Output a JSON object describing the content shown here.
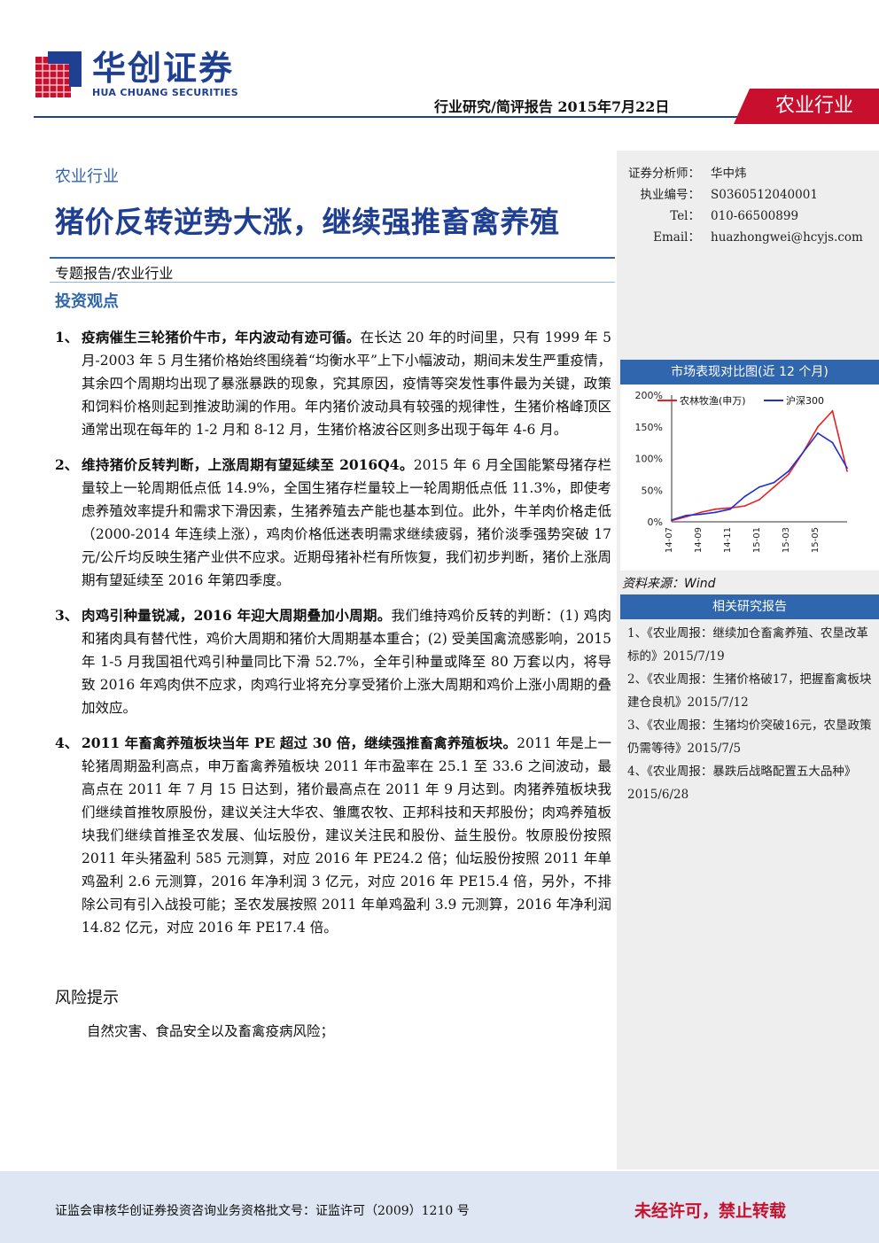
{
  "header": {
    "logo_cn": "华创证券",
    "logo_en": "HUA CHUANG SECURITIES",
    "report_meta": "行业研究/简评报告  2015年7月22日",
    "sector_tab": "农业行业"
  },
  "main": {
    "sector_label": "农业行业",
    "title": "猪价反转逆势大涨，继续强推畜禽养殖",
    "report_type": "专题报告/农业行业",
    "invest_heading": "投资观点",
    "points": [
      {
        "num": "1、",
        "lead": "疫病催生三轮猪价牛市，年内波动有迹可循。",
        "text": "在长达 20 年的时间里，只有 1999 年 5 月-2003 年 5 月生猪价格始终围绕着“均衡水平”上下小幅波动，期间未发生严重疫情，其余四个周期均出现了暴涨暴跌的现象，究其原因，疫情等突发性事件最为关键，政策和饲料价格则起到推波助澜的作用。年内猪价波动具有较强的规律性，生猪价格峰顶区通常出现在每年的 1-2 月和 8-12 月，生猪价格波谷区则多出现于每年 4-6 月。"
      },
      {
        "num": "2、",
        "lead": "维持猪价反转判断，上涨周期有望延续至 2016Q4。",
        "text": "2015 年 6 月全国能繁母猪存栏量较上一轮周期低点低 14.9%，全国生猪存栏量较上一轮周期低点低 11.3%，即使考虑养殖效率提升和需求下滑因素，生猪养殖去产能也基本到位。此外，牛羊肉价格走低（2000-2014 年连续上涨），鸡肉价格低迷表明需求继续疲弱，猪价淡季强势突破 17 元/公斤均反映生猪产业供不应求。近期母猪补栏有所恢复，我们初步判断，猪价上涨周期有望延续至 2016 年第四季度。"
      },
      {
        "num": "3、",
        "lead": "肉鸡引种量锐减，2016 年迎大周期叠加小周期。",
        "text": "我们维持鸡价反转的判断：(1) 鸡肉和猪肉具有替代性，鸡价大周期和猪价大周期基本重合；(2) 受美国禽流感影响，2015 年 1-5 月我国祖代鸡引种量同比下滑 52.7%，全年引种量或降至 80 万套以内，将导致 2016 年鸡肉供不应求，肉鸡行业将充分享受猪价上涨大周期和鸡价上涨小周期的叠加效应。"
      },
      {
        "num": "4、",
        "lead": "2011 年畜禽养殖板块当年 PE 超过 30 倍，继续强推畜禽养殖板块。",
        "text": "2011 年是上一轮猪周期盈利高点，申万畜禽养殖板块 2011 年市盈率在 25.1 至 33.6 之间波动，最高点在 2011 年 7 月 15 日达到，猪价最高点在 2011 年 9 月达到。肉猪养殖板块我们继续首推牧原股份，建议关注大华农、雏鹰农牧、正邦科技和天邦股份；肉鸡养殖板块我们继续首推圣农发展、仙坛股份，建议关注民和股份、益生股份。牧原股份按照 2011 年头猪盈利 585 元测算，对应 2016 年 PE24.2 倍；仙坛股份按照 2011 年单鸡盈利 2.6 元测算，2016 年净利润 3 亿元，对应 2016 年 PE15.4 倍，另外，不排除公司有引入战投可能；圣农发展按照 2011 年单鸡盈利 3.9 元测算，2016 年净利润 14.82 亿元，对应 2016 年 PE17.4 倍。"
      }
    ],
    "risk_heading": "风险提示",
    "risk_text": "自然灾害、食品安全以及畜禽疫病风险；"
  },
  "sidebar": {
    "analyst": [
      {
        "k": "证券分析师：",
        "v": "华中炜"
      },
      {
        "k": "执业编号：",
        "v": "S0360512040001"
      },
      {
        "k": "Tel：",
        "v": "010-66500899"
      },
      {
        "k": "Email：",
        "v": "huazhongwei@hcyjs.com"
      }
    ],
    "chart_heading": "市场表现对比图(近 12 个月)",
    "source": "资料来源：Wind",
    "reports_heading": "相关研究报告",
    "reports": [
      "1、《农业周报：继续加仓畜禽养殖、农垦改革标的》2015/7/19",
      "2、《农业周报：生猪价格破17，把握畜禽板块建仓良机》2015/7/12",
      "3、《农业周报：生猪均价突破16元，农垦政策仍需等待》2015/7/5",
      "4、《农业周报：暴跌后战略配置五大品种》2015/6/28"
    ]
  },
  "chart_data": {
    "type": "line",
    "title": "市场表现对比图(近 12 个月)",
    "xlabel": "",
    "ylabel": "",
    "x": [
      "14-07",
      "14-08",
      "14-09",
      "14-10",
      "14-11",
      "14-12",
      "15-01",
      "15-02",
      "15-03",
      "15-04",
      "15-05",
      "15-06",
      "15-07"
    ],
    "x_ticks": [
      "14-07",
      "14-09",
      "14-11",
      "15-01",
      "15-03",
      "15-05"
    ],
    "y_ticks": [
      "0%",
      "50%",
      "100%",
      "150%",
      "200%"
    ],
    "ylim": [
      0,
      200
    ],
    "legend_position": "top",
    "series": [
      {
        "name": "农林牧渔(申万)",
        "color": "#e8201f",
        "values": [
          2,
          8,
          15,
          20,
          22,
          25,
          35,
          55,
          75,
          110,
          150,
          175,
          80
        ]
      },
      {
        "name": "沪深300",
        "color": "#1d2fd6",
        "values": [
          3,
          10,
          12,
          15,
          20,
          40,
          55,
          62,
          80,
          110,
          140,
          125,
          85
        ]
      }
    ]
  },
  "footer": {
    "license": "证监会审核华创证券投资咨询业务资格批文号：证监许可（2009）1210 号",
    "notice": "未经许可，禁止转载"
  }
}
